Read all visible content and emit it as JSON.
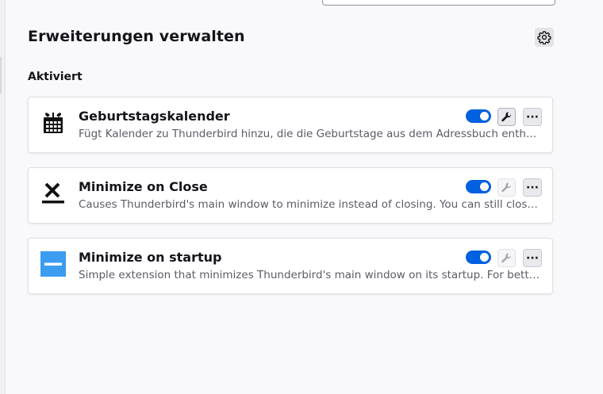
{
  "header": {
    "title": "Erweiterungen verwalten",
    "settings_icon": "gear-icon"
  },
  "section": {
    "label": "Aktiviert"
  },
  "extensions": [
    {
      "name": "Geburtstagskalender",
      "description": "Fügt Kalender zu Thunderbird hinzu, die die Geburtstage aus dem Adressbuch enthalten.",
      "enabled": true,
      "options_available": true,
      "icon": "calendar-gift-icon",
      "more_label": "···"
    },
    {
      "name": "Minimize on Close",
      "description": "Causes Thunderbird's main window to minimize instead of closing. You can still close Thunderbird via the menu.",
      "enabled": true,
      "options_available": false,
      "icon": "minimize-close-icon",
      "more_label": "···"
    },
    {
      "name": "Minimize on startup",
      "description": "Simple extension that minimizes Thunderbird's main window on its startup. For better results use with other extensions.",
      "enabled": true,
      "options_available": false,
      "icon": "minimize-startup-icon",
      "more_label": "···"
    }
  ],
  "colors": {
    "accent": "#0060df",
    "startup_icon": "#3b9cf0"
  }
}
